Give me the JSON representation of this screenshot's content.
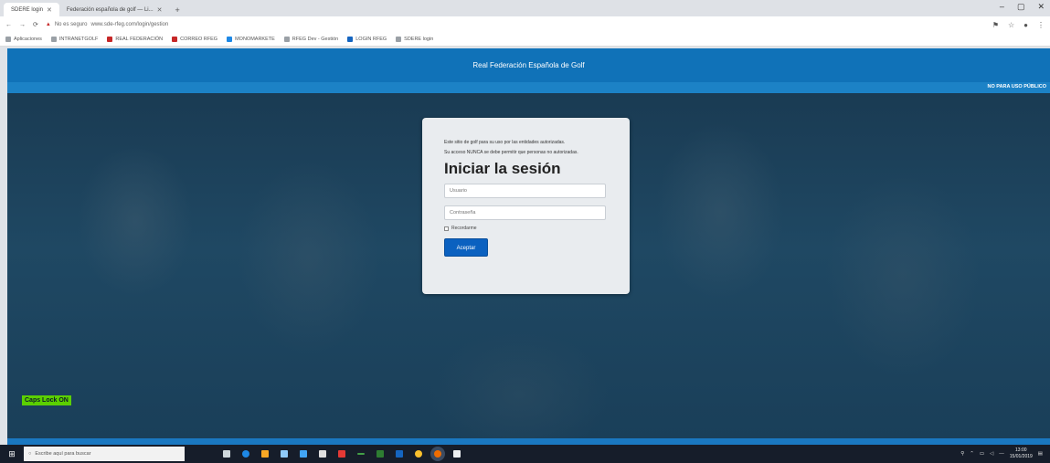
{
  "browser": {
    "tabs": [
      {
        "label": "SDERE login",
        "active": true
      },
      {
        "label": "Federación española de golf — Li..."
      }
    ],
    "new_tab": "+",
    "window_controls": [
      "–",
      "▢",
      "✕"
    ],
    "url_warning": "No es seguro",
    "url": "www.sde-rfeg.com/login/gestion",
    "bookmarks": [
      "Aplicaciones",
      "INTRANETGOLF",
      "REAL FEDERACIÓN",
      "CORREO RFEG",
      "MONOMARKETE",
      "RFEG Dev - Gestión",
      "LOGIN RFEG",
      "SDERE login"
    ]
  },
  "site": {
    "title": "Real Federación Española de Golf",
    "notice": "NO PARA USO PÚBLICO"
  },
  "login": {
    "intro_1": "Este sitio de golf para su uso por las entidades autorizadas.",
    "intro_2": "Su acceso NUNCA se debe permitir que personas no autorizadas.",
    "heading": "Iniciar la sesión",
    "username_placeholder": "Usuario",
    "password_placeholder": "Contraseña",
    "remember_label": "Recordarme",
    "submit_label": "Aceptar"
  },
  "capslock": "Caps Lock ON",
  "taskbar": {
    "search_placeholder": "Escribe aquí para buscar",
    "clock_time": "13:00",
    "clock_date": "15/01/2019"
  },
  "colors": {
    "header_blue": "#1072b8",
    "button_blue": "#0b61c0",
    "capslock_green": "#5bd000"
  }
}
